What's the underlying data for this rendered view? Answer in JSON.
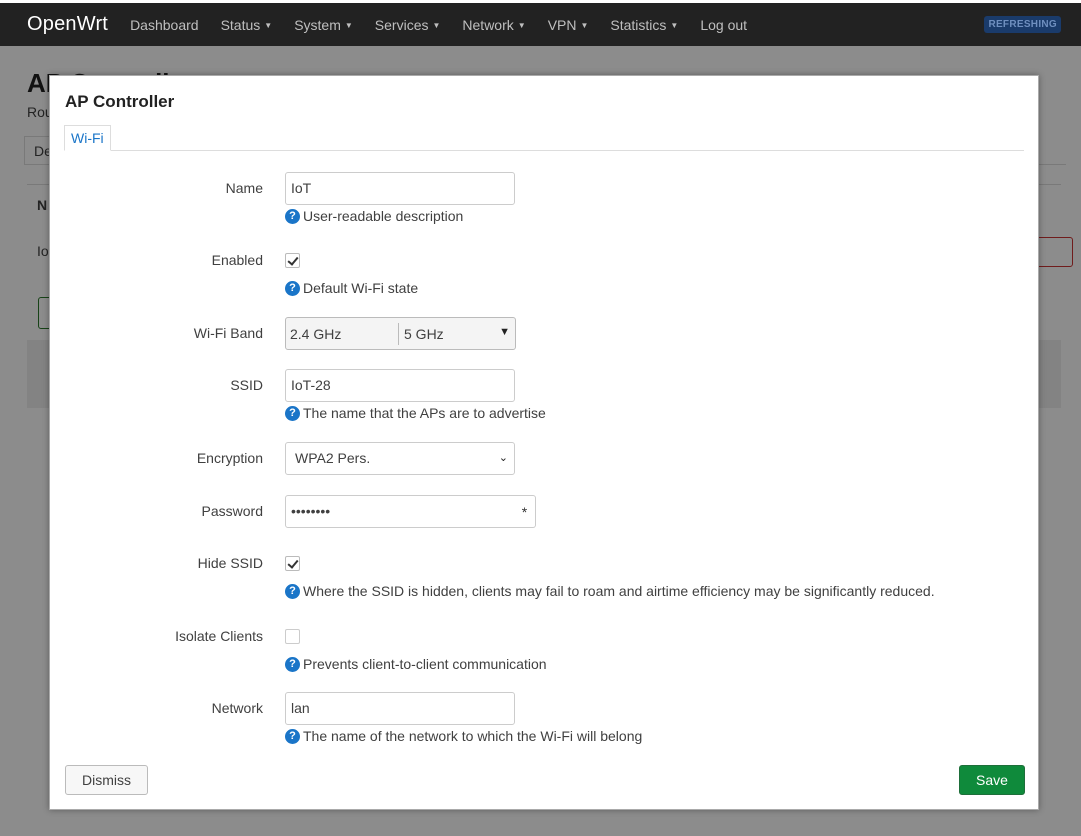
{
  "navbar": {
    "brand": "OpenWrt",
    "items": [
      {
        "label": "Dashboard",
        "caret": false
      },
      {
        "label": "Status",
        "caret": true
      },
      {
        "label": "System",
        "caret": true
      },
      {
        "label": "Services",
        "caret": true
      },
      {
        "label": "Network",
        "caret": true
      },
      {
        "label": "VPN",
        "caret": true
      },
      {
        "label": "Statistics",
        "caret": true
      },
      {
        "label": "Log out",
        "caret": false
      }
    ],
    "badge": "REFRESHING"
  },
  "background": {
    "title": "AP Controller",
    "subtitle_fragment": "Rou",
    "tab_fragment": "De",
    "col_header_fragment": "N",
    "cell_fragment": "Io"
  },
  "modal": {
    "title": "AP Controller",
    "tab": "Wi-Fi",
    "fields": {
      "name": {
        "label": "Name",
        "value": "IoT",
        "help": "User-readable description"
      },
      "enabled": {
        "label": "Enabled",
        "checked": true,
        "help": "Default Wi-Fi state"
      },
      "band": {
        "label": "Wi-Fi Band",
        "options": [
          "2.4 GHz",
          "5 GHz"
        ]
      },
      "ssid": {
        "label": "SSID",
        "value": "IoT-28",
        "help": "The name that the APs are to advertise"
      },
      "encryption": {
        "label": "Encryption",
        "value": "WPA2 Pers."
      },
      "password": {
        "label": "Password",
        "value": "••••••••",
        "toggle": "*"
      },
      "hide_ssid": {
        "label": "Hide SSID",
        "checked": true,
        "help": "Where the SSID is hidden, clients may fail to roam and airtime efficiency may be significantly reduced."
      },
      "isolate": {
        "label": "Isolate Clients",
        "checked": false,
        "help": "Prevents client-to-client communication"
      },
      "network": {
        "label": "Network",
        "value": "lan",
        "help": "The name of the network to which the Wi-Fi will belong"
      }
    },
    "buttons": {
      "dismiss": "Dismiss",
      "save": "Save"
    }
  },
  "help_icon_glyph": "?",
  "colors": {
    "accent": "#1a75c8",
    "save": "#0f8a3b",
    "navbar": "#222222"
  }
}
